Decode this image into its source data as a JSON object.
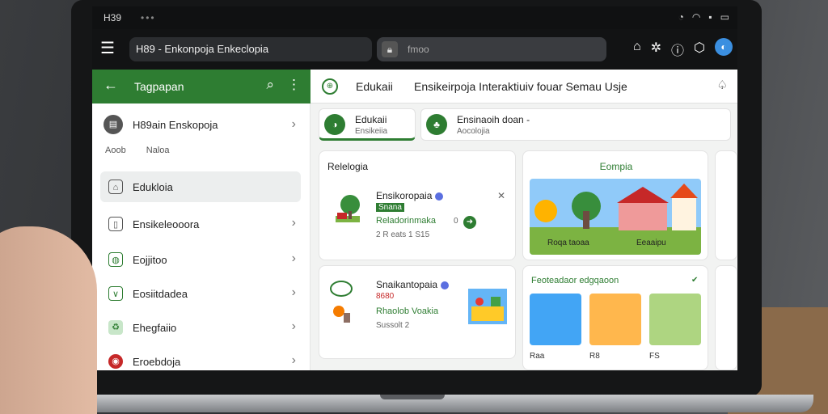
{
  "status": {
    "time": "H39"
  },
  "topbar": {
    "title": "H89 - Enkonpoja Enkeclopia",
    "search_placeholder": "fmoo"
  },
  "sidebar": {
    "header_title": "Tagpapan",
    "top_item": {
      "label": "H89ain Enskopoja"
    },
    "sub_labels": [
      "Aoob",
      "Naloa"
    ],
    "items": [
      {
        "label": "Edukloia",
        "active": true,
        "color": "#555"
      },
      {
        "label": "Ensikeleooora",
        "color": "#555"
      },
      {
        "label": "Eojjitoo",
        "color": "#2e7d32"
      },
      {
        "label": "Eosiitdadea",
        "color": "#2e7d32"
      },
      {
        "label": "Ehegfaiio",
        "color": "#43a047"
      },
      {
        "label": "Eroebdoja",
        "color": "#c62828"
      }
    ]
  },
  "main": {
    "header_title": "Edukaii",
    "header_sub": "Ensikeirpoja Interaktiuiv fouar Semau Usje",
    "chips": [
      {
        "t1": "Edukaii",
        "t2": "Ensikeiia"
      },
      {
        "t1": "Ensinaoih doan -",
        "t2": "Aocolojia"
      }
    ],
    "card1": {
      "title": "Relelogia",
      "row_title": "Ensikoropaia",
      "row_badge": "Snana",
      "row_sub": "Reladorinmaka",
      "row_num": "0",
      "row_meta": "2 R eats 1 S15"
    },
    "card2": {
      "row_title": "Snaikantopaia",
      "row_badge": "8680",
      "row_sub": "Rhaolob Voakia",
      "row_meta": "Sussolt 2"
    },
    "card3": {
      "title": "Eompia",
      "cap1": "Roqa taoaa",
      "cap2": "Eeaaipu"
    },
    "card4": {
      "title": "Feoteadaor edgqaoon",
      "t1": "Raa",
      "t2": "R8",
      "t3": "FS"
    }
  }
}
